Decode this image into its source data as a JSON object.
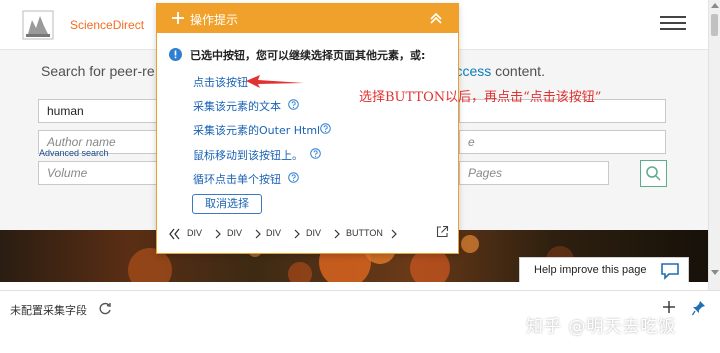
{
  "header": {
    "brand": "ScienceDirect"
  },
  "search": {
    "heading_left": "Search for peer-re",
    "heading_right_link": "n access",
    "heading_right_rest": " content.",
    "keywords_value": "human",
    "author_placeholder": "Author name",
    "volume_placeholder": "Volume",
    "journal_partial_placeholder": "e",
    "pages_placeholder": "Pages",
    "advanced_label": "Advanced search"
  },
  "hero": {
    "help_label": "Help improve this page"
  },
  "bottombar": {
    "label": "未配置采集字段",
    "watermark": "知乎 @明天去吃饭"
  },
  "popup": {
    "title": "操作提示",
    "message": "已选中按钮，您可以继续选择页面其他元素，或:",
    "actions": [
      "点击该按钮",
      "采集该元素的文本",
      "采集该元素的Outer Html",
      "鼠标移动到该按钮上。",
      "循环点击单个按钮"
    ],
    "cancel_label": "取消选择",
    "breadcrumbs": [
      "DIV",
      "DIV",
      "DIV",
      "DIV",
      "BUTTON"
    ]
  },
  "annotation": {
    "text": "选择BUTTON以后，再点击“点击该按钮”"
  },
  "colors": {
    "popup_header": "#f0a12b",
    "brand": "#f36d21",
    "link": "#1a62b4",
    "annotation": "#e23131",
    "search_button_border": "#5aae82"
  }
}
